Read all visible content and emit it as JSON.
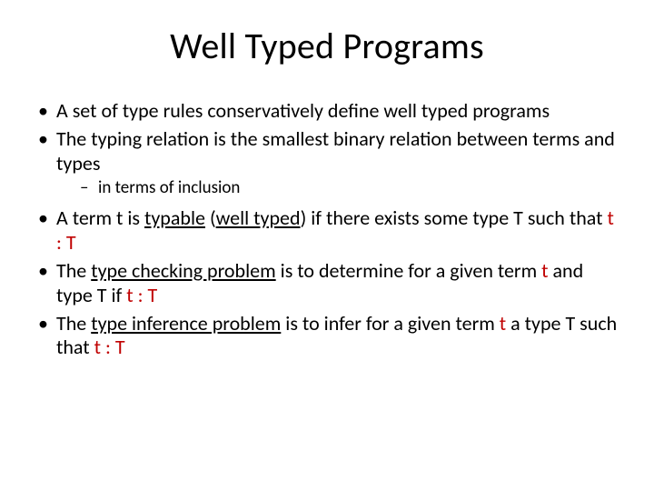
{
  "title": "Well Typed Programs",
  "b1": "A set of type rules conservatively define well typed programs",
  "b2": "The typing relation is the smallest binary relation between terms and types",
  "b2s1": "in terms of inclusion",
  "b3a": "A term t is ",
  "b3b": "typable",
  "b3c": " (",
  "b3d": "well typed",
  "b3e": ") if there exists some type T such that ",
  "b3f": "t : T",
  "b4a": "The ",
  "b4b": "type checking problem",
  "b4c": " is to determine for a given term ",
  "b4d": "t",
  "b4e": " and type T if ",
  "b4f": "t : T",
  "b5a": "The ",
  "b5b": "type inference problem",
  "b5c": " is to infer for a given term ",
  "b5d": "t",
  "b5e": " a type T such that ",
  "b5f": "t : T"
}
